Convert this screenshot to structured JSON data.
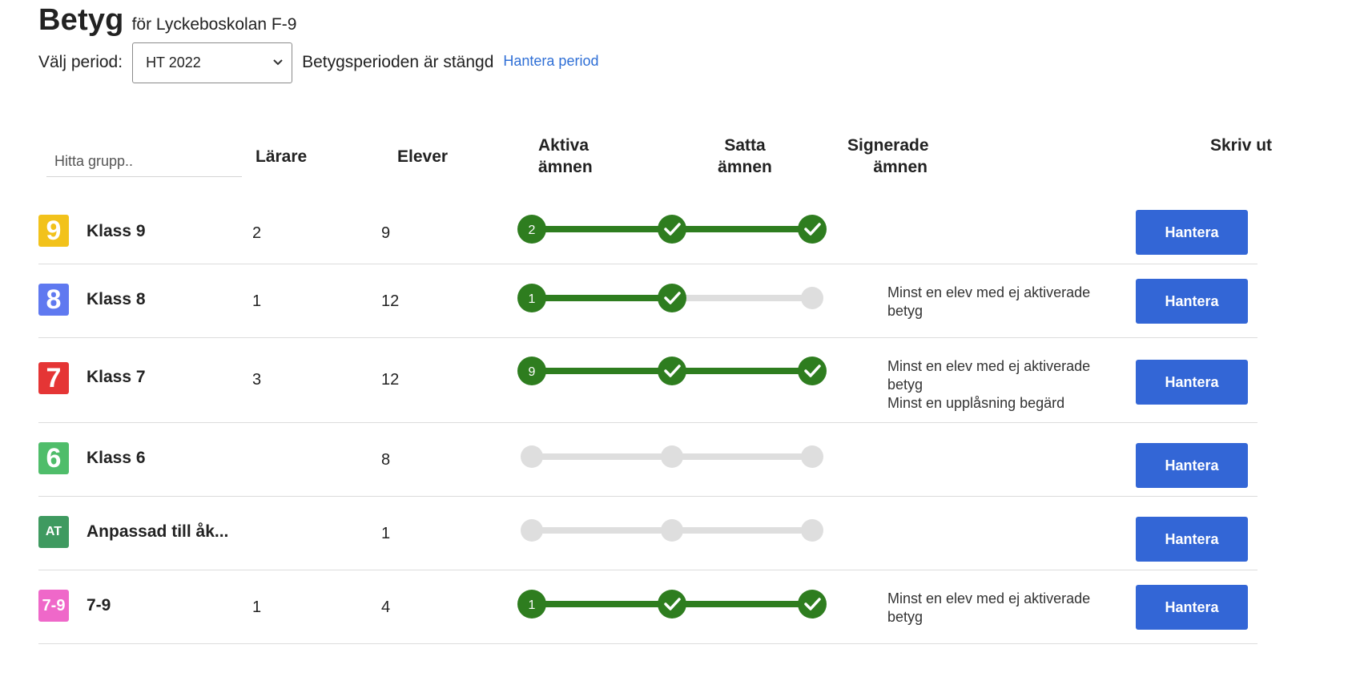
{
  "page": {
    "title": "Betyg",
    "subtitle": "för Lyckeboskolan F-9"
  },
  "period": {
    "label": "Välj period:",
    "selected": "HT 2022",
    "status": "Betygsperioden är stängd",
    "manage_link": "Hantera period"
  },
  "table": {
    "search_placeholder": "Hitta grupp..",
    "columns": {
      "teachers": "Lärare",
      "students": "Elever",
      "active_1": "Aktiva",
      "active_2": "ämnen",
      "set_1": "Satta",
      "set_2": "ämnen",
      "signed_1": "Signerade",
      "signed_2": "ämnen",
      "print": "Skriv ut"
    },
    "button_label": "Hantera",
    "rows": [
      {
        "badge": "9",
        "badge_color": "#f2c21b",
        "name": "Klass 9",
        "teachers": "2",
        "students": "9",
        "active": "2",
        "set_done": true,
        "signed_done": true,
        "notes": [
          "",
          "",
          ""
        ]
      },
      {
        "badge": "8",
        "badge_color": "#5f79f0",
        "name": "Klass 8",
        "teachers": "1",
        "students": "12",
        "active": "1",
        "set_done": true,
        "signed_done": false,
        "notes": [
          "Minst en elev med ej aktiverade",
          "betyg",
          ""
        ]
      },
      {
        "badge": "7",
        "badge_color": "#e53535",
        "name": "Klass 7",
        "teachers": "3",
        "students": "12",
        "active": "9",
        "set_done": true,
        "signed_done": true,
        "notes": [
          "Minst en elev med ej aktiverade",
          "betyg",
          "Minst en upplåsning begärd"
        ]
      },
      {
        "badge": "6",
        "badge_color": "#4fbd6a",
        "name": "Klass 6",
        "teachers": "",
        "students": "8",
        "active": "",
        "set_done": false,
        "signed_done": false,
        "notes": [
          "",
          "",
          ""
        ]
      },
      {
        "badge": "AT",
        "badge_color": "#3f9a60",
        "name": "Anpassad till åk...",
        "teachers": "",
        "students": "1",
        "active": "",
        "set_done": false,
        "signed_done": false,
        "notes": [
          "",
          "",
          ""
        ]
      },
      {
        "badge": "7-9",
        "badge_color": "#ef68c9",
        "name": "7-9",
        "teachers": "1",
        "students": "4",
        "active": "1",
        "set_done": true,
        "signed_done": true,
        "notes": [
          "Minst en elev med ej aktiverade",
          "betyg",
          ""
        ]
      }
    ]
  },
  "colors": {
    "progress_done": "#2e7d1f",
    "progress_pending": "#dedede",
    "button": "#3366d6",
    "link": "#2f6fd6"
  },
  "icons": {
    "dropdown": "chevron-down-icon",
    "completed": "check-icon"
  }
}
